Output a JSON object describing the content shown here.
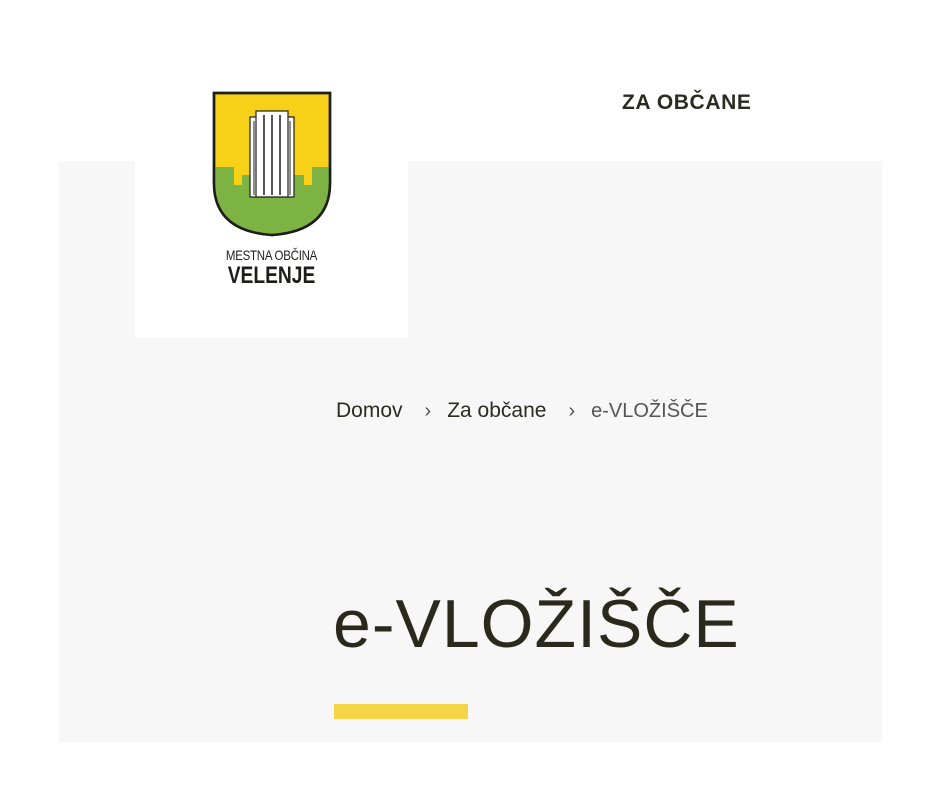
{
  "header": {
    "logo": {
      "line1": "MESTNA OBČINA",
      "line2": "VELENJE",
      "crest_icon": "velenje-coat-of-arms-icon"
    },
    "nav": {
      "za_obcane": "ZA OBČANE"
    }
  },
  "breadcrumb": {
    "items": [
      "Domov",
      "Za občane"
    ],
    "current": "e-VLOŽIŠČE",
    "separator": "›"
  },
  "main": {
    "title": "e-VLOŽIŠČE"
  },
  "colors": {
    "accent": "#f5d547",
    "crest_yellow": "#f7d117",
    "crest_green": "#7cb342",
    "hero_background": "#f7f7f7",
    "text_dark": "#2a2a1c"
  }
}
